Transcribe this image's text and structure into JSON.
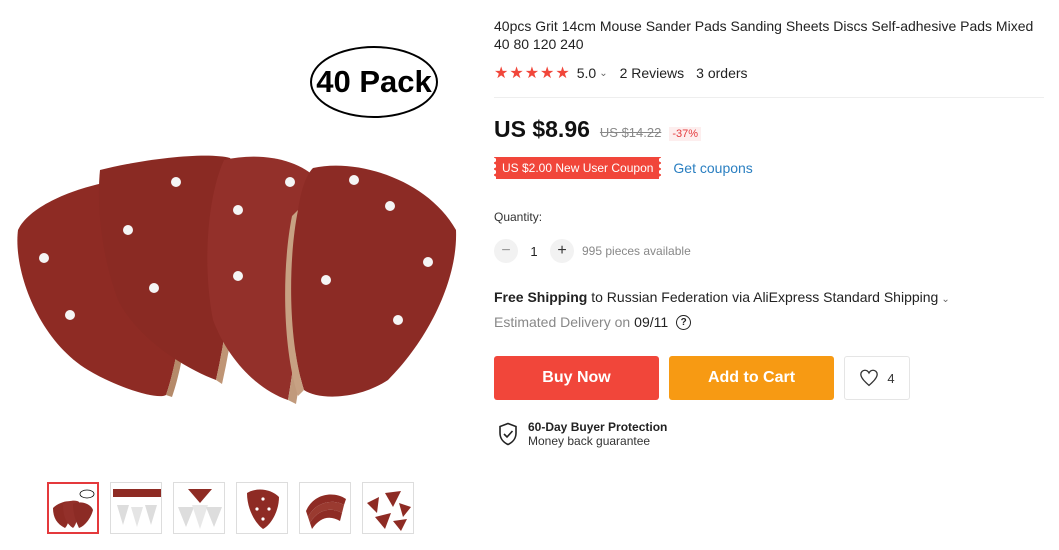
{
  "gallery": {
    "pack_label": "40 Pack",
    "thumbnail_count": 6
  },
  "product": {
    "title": "40pcs Grit 14cm Mouse Sander Pads Sanding Sheets Discs Self-adhesive Pads Mixed 40 80 120 240",
    "stars": "★★★★★",
    "rating": "5.0",
    "reviews": "2 Reviews",
    "orders": "3 orders"
  },
  "price": {
    "current": "US $8.96",
    "original": "US $14.22",
    "discount": "-37%"
  },
  "coupon": {
    "label": "US $2.00 New User Coupon",
    "link": "Get coupons"
  },
  "quantity": {
    "label": "Quantity:",
    "minus": "−",
    "value": "1",
    "plus": "+",
    "available": "995 pieces available"
  },
  "shipping": {
    "free": "Free Shipping",
    "destination": " to Russian Federation via AliExpress Standard Shipping",
    "delivery_label": "Estimated Delivery on",
    "delivery_date": "09/11"
  },
  "actions": {
    "buy_now": "Buy Now",
    "add_to_cart": "Add to Cart",
    "wishlist_count": "4"
  },
  "protection": {
    "title": "60-Day Buyer Protection",
    "subtitle": "Money back guarantee"
  },
  "colors": {
    "accent": "#f1463a",
    "cart": "#f79a13",
    "link": "#2a7fc1",
    "sandpaper": "#8e2b24"
  }
}
